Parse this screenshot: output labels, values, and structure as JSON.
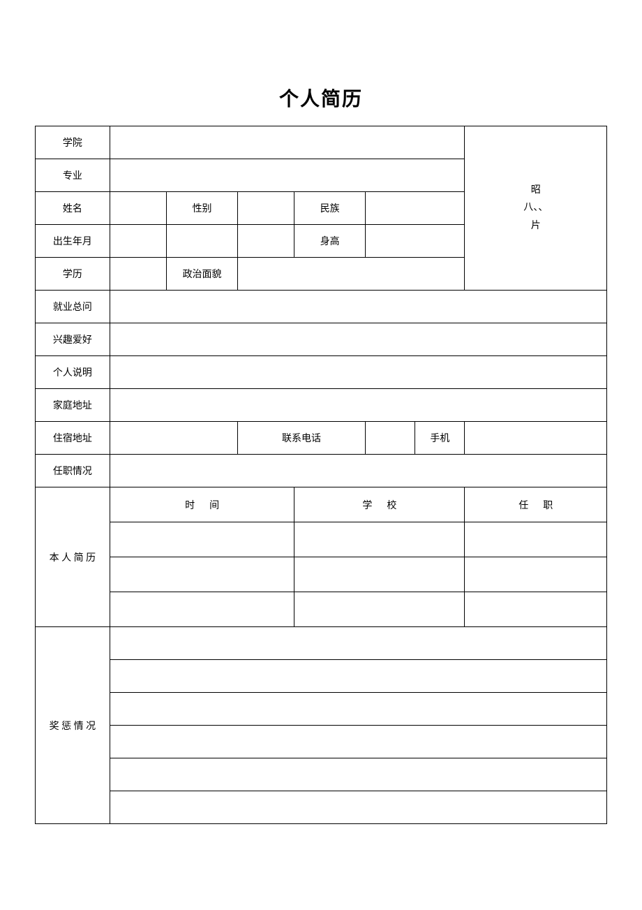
{
  "title": "个人简历",
  "labels": {
    "college": "学院",
    "major": "专业",
    "name": "姓名",
    "gender": "性别",
    "ethnicity": "民族",
    "birth": "出生年月",
    "height": "身高",
    "education": "学历",
    "politics": "政治面貌",
    "employment": "就业总问",
    "hobby": "兴趣爱好",
    "personal_desc": "个人说明",
    "home_address": "家庭地址",
    "dorm_address": "住宿地址",
    "contact_phone": "联系电话",
    "mobile": "手机",
    "position_status": "任职情况",
    "resume": "本 人 简 历",
    "rewards": "奖 惩 情 况",
    "photo_line1": "昭",
    "photo_line2": "八、、",
    "photo_line3": "片",
    "header_time": "时",
    "header_time2": "间",
    "header_school": "学",
    "header_school2": "校",
    "header_position": "任",
    "header_position2": "职"
  },
  "values": {
    "college": "",
    "major": "",
    "name": "",
    "gender": "",
    "ethnicity": "",
    "birth": "",
    "birth_extra": "",
    "height": "",
    "education": "",
    "politics": "",
    "employment": "",
    "hobby": "",
    "personal_desc": "",
    "home_address": "",
    "dorm_address": "",
    "contact_phone": "",
    "mobile": "",
    "position_status": ""
  },
  "resume_rows": [
    {
      "time": "",
      "school": "",
      "position": ""
    },
    {
      "time": "",
      "school": "",
      "position": ""
    },
    {
      "time": "",
      "school": "",
      "position": ""
    }
  ],
  "reward_rows": [
    "",
    "",
    "",
    "",
    "",
    ""
  ]
}
